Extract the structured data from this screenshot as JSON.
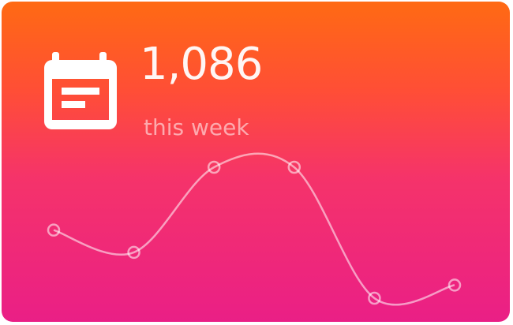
{
  "card": {
    "icon": "calendar-icon",
    "value": "1,086",
    "label": "this week",
    "colors": {
      "gradient_top": "#ff6a13",
      "gradient_bottom": "#ea1f86",
      "foreground": "#ffffff"
    }
  },
  "chart_data": {
    "type": "line",
    "title": "",
    "xlabel": "",
    "ylabel": "",
    "x": [
      1,
      2,
      3,
      4,
      5,
      6
    ],
    "values": [
      52,
      35,
      100,
      100,
      0,
      10
    ],
    "ylim": [
      0,
      100
    ],
    "grid": false,
    "smooth": true,
    "markers": "open-circle"
  }
}
